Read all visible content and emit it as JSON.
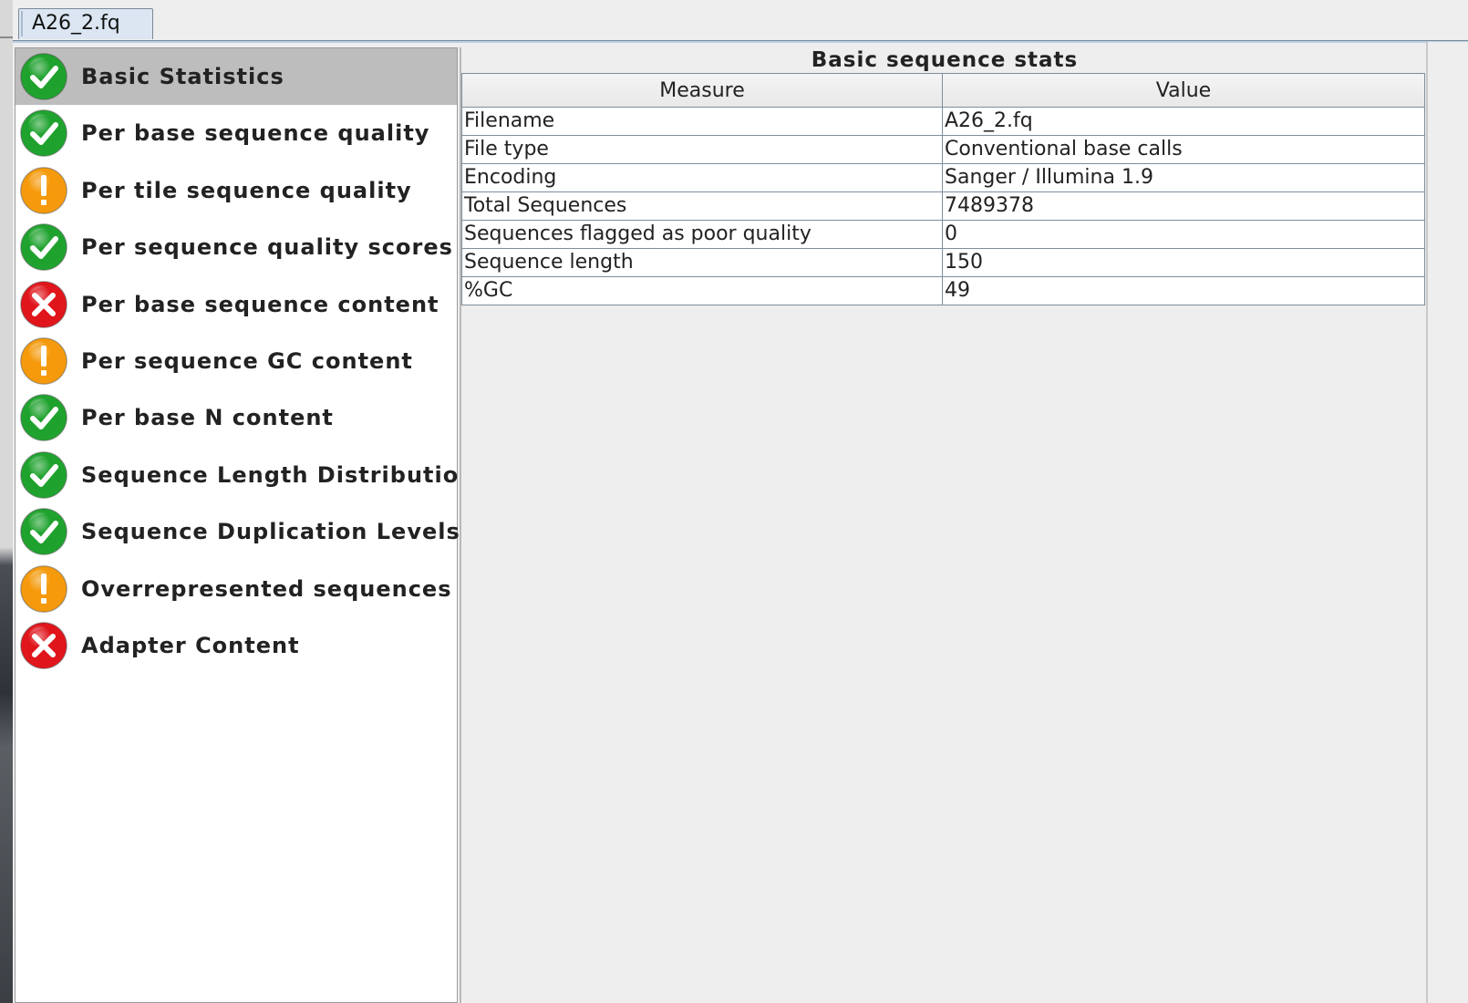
{
  "tab": {
    "label": "A26_2.fq"
  },
  "modules": [
    {
      "label": "Basic Statistics",
      "status": "pass",
      "icon": "pass-icon",
      "selected": true
    },
    {
      "label": "Per base sequence quality",
      "status": "pass",
      "icon": "pass-icon"
    },
    {
      "label": "Per tile sequence quality",
      "status": "warn",
      "icon": "warning-icon"
    },
    {
      "label": "Per sequence quality scores",
      "status": "pass",
      "icon": "pass-icon"
    },
    {
      "label": "Per base sequence content",
      "status": "fail",
      "icon": "fail-icon"
    },
    {
      "label": "Per sequence GC content",
      "status": "warn",
      "icon": "warning-icon"
    },
    {
      "label": "Per base N content",
      "status": "pass",
      "icon": "pass-icon"
    },
    {
      "label": "Sequence Length Distribution",
      "status": "pass",
      "icon": "pass-icon"
    },
    {
      "label": "Sequence Duplication Levels",
      "status": "pass",
      "icon": "pass-icon"
    },
    {
      "label": "Overrepresented sequences",
      "status": "warn",
      "icon": "warning-icon"
    },
    {
      "label": "Adapter Content",
      "status": "fail",
      "icon": "fail-icon"
    }
  ],
  "stats": {
    "title": "Basic sequence stats",
    "columns": [
      "Measure",
      "Value"
    ],
    "rows": [
      [
        "Filename",
        "A26_2.fq"
      ],
      [
        "File type",
        "Conventional base calls"
      ],
      [
        "Encoding",
        "Sanger / Illumina 1.9"
      ],
      [
        "Total Sequences",
        "7489378"
      ],
      [
        "Sequences flagged as poor quality",
        "0"
      ],
      [
        "Sequence length",
        "150"
      ],
      [
        "%GC",
        "49"
      ]
    ]
  },
  "colors": {
    "pass": "#1fa32e",
    "warn": "#f59a0c",
    "fail": "#e0161c",
    "selected_row": "#bdbdbd",
    "table_border": "#7f8e9c"
  }
}
